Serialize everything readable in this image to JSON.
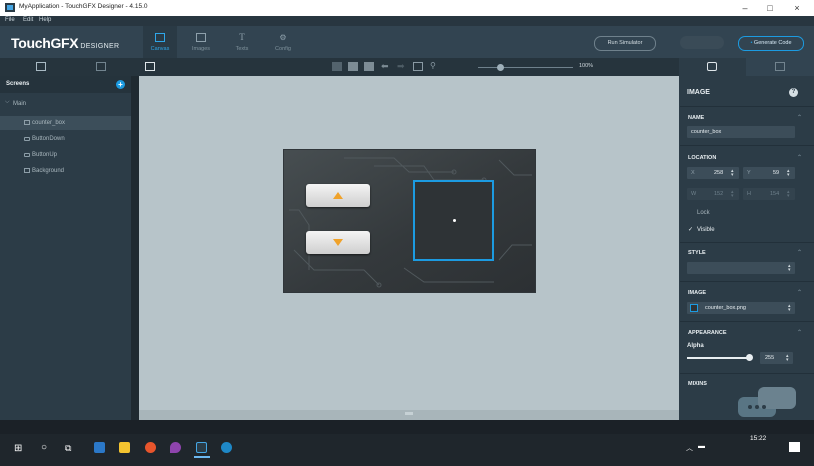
{
  "window": {
    "title": "MyApplication - TouchGFX Designer - 4.15.0",
    "minimize": "–",
    "maximize": "□",
    "close": "×"
  },
  "menu": [
    "File",
    "Edit",
    "Help"
  ],
  "logo": {
    "main": "TouchGFX",
    "sub": "DESIGNER"
  },
  "tabs": [
    {
      "label": "Canvas",
      "active": true
    },
    {
      "label": "Images",
      "active": false
    },
    {
      "label": "Texts",
      "active": false
    },
    {
      "label": "Config",
      "active": false
    }
  ],
  "actions": {
    "run_simulator": "Run Simulator",
    "generate_code": "Generate Code",
    "generate_code_icon": "•"
  },
  "canvas_toolbar": {
    "zoom": "100%"
  },
  "screens_panel": {
    "header": "Screens",
    "add_icon": "+",
    "screen_name": "Main",
    "widgets": [
      "counter_box",
      "ButtonDown",
      "ButtonUp",
      "Background"
    ],
    "selected": "counter_box"
  },
  "properties": {
    "header": "IMAGE",
    "help_icon": "?",
    "name_label": "NAME",
    "name_value": "counter_box",
    "location_label": "LOCATION",
    "x_label": "X",
    "x_value": "258",
    "y_label": "Y",
    "y_value": "59",
    "w_label": "W",
    "w_value": "152",
    "h_label": "H",
    "h_value": "154",
    "lock_label": "Lock",
    "visible_label": "Visible",
    "visible_check": "✓",
    "style_label": "STYLE",
    "image_label": "IMAGE",
    "image_value": "counter_box.png",
    "appearance_label": "APPEARANCE",
    "alpha_label": "Alpha",
    "alpha_value": "255",
    "mixins_label": "MIXINS"
  },
  "taskbar": {
    "time": "15:22"
  },
  "colors": {
    "accent": "#1c9be1",
    "arrow": "#f0a22a",
    "panel": "#2c3c47",
    "toolbar": "#324451",
    "canvas_bg": "#b7c4c9"
  }
}
